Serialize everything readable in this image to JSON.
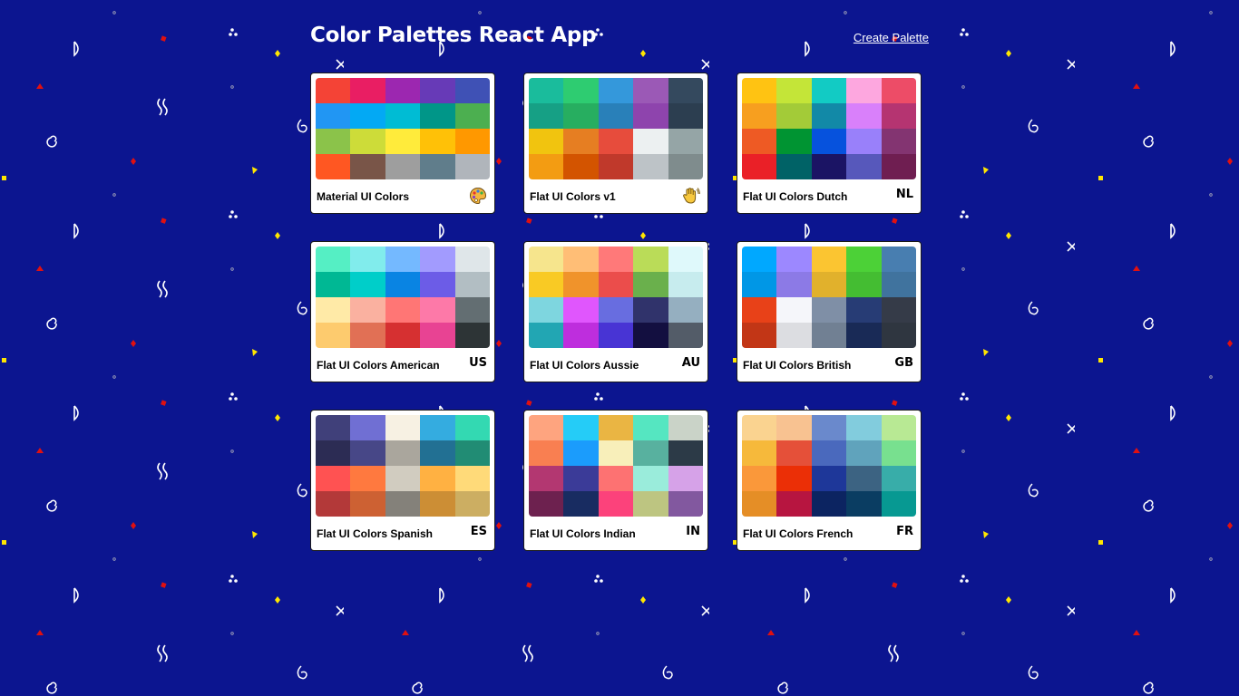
{
  "app": {
    "title": "Color Palettes React App",
    "create_link": "Create Palette"
  },
  "theme": {
    "background": "#0c1590"
  },
  "palettes": [
    {
      "name": "Material UI Colors",
      "emoji": "",
      "icon": "artist-palette-icon",
      "colors": [
        "#f44336",
        "#e91e63",
        "#9c27b0",
        "#673ab7",
        "#3f51b5",
        "#2196f3",
        "#03a9f4",
        "#00bcd4",
        "#009688",
        "#4caf50",
        "#8bc34a",
        "#cddc39",
        "#ffeb3b",
        "#ffc107",
        "#ff9800",
        "#ff5722",
        "#795548",
        "#9e9e9e",
        "#607d8b",
        "#b0b5bb"
      ]
    },
    {
      "name": "Flat UI Colors v1",
      "emoji": "",
      "icon": "waving-hand-icon",
      "colors": [
        "#1abc9c",
        "#2ecc71",
        "#3498db",
        "#9b59b6",
        "#34495e",
        "#16a085",
        "#27ae60",
        "#2980b9",
        "#8e44ad",
        "#2c3e50",
        "#f1c40f",
        "#e67e22",
        "#e74c3c",
        "#ecf0f1",
        "#95a5a6",
        "#f39c12",
        "#d35400",
        "#c0392b",
        "#bdc3c7",
        "#7f8c8d"
      ]
    },
    {
      "name": "Flat UI Colors Dutch",
      "emoji": "NL",
      "icon": "",
      "colors": [
        "#ffc312",
        "#c4e538",
        "#12cbc4",
        "#fda7df",
        "#ed4c67",
        "#f79f1f",
        "#a3cb38",
        "#1289a7",
        "#d980fa",
        "#b53471",
        "#ee5a24",
        "#009432",
        "#0652dd",
        "#9980fa",
        "#833471",
        "#ea2027",
        "#006266",
        "#1b1464",
        "#5758bb",
        "#6f1e51"
      ]
    },
    {
      "name": "Flat UI Colors American",
      "emoji": "US",
      "icon": "",
      "colors": [
        "#55efc4",
        "#81ecec",
        "#74b9ff",
        "#a29bfe",
        "#dfe6e9",
        "#00b894",
        "#00cec9",
        "#0984e3",
        "#6c5ce7",
        "#b2bec3",
        "#ffeaa7",
        "#fab1a0",
        "#ff7675",
        "#fd79a8",
        "#636e72",
        "#fdcb6e",
        "#e17055",
        "#d63031",
        "#e84393",
        "#2d3436"
      ]
    },
    {
      "name": "Flat UI Colors Aussie",
      "emoji": "AU",
      "icon": "",
      "colors": [
        "#f6e58d",
        "#ffbe76",
        "#ff7979",
        "#badc58",
        "#dff9fb",
        "#f9ca24",
        "#f0932b",
        "#eb4d4b",
        "#6ab04c",
        "#c7ecee",
        "#7ed6df",
        "#e056fd",
        "#686de0",
        "#30336b",
        "#95afc0",
        "#22a6b3",
        "#be2edd",
        "#4834d4",
        "#130f40",
        "#535c68"
      ]
    },
    {
      "name": "Flat UI Colors British",
      "emoji": "GB",
      "icon": "",
      "colors": [
        "#00a8ff",
        "#9c88ff",
        "#fbc531",
        "#4cd137",
        "#487eb0",
        "#0097e6",
        "#8c7ae6",
        "#e1b12c",
        "#44bd32",
        "#40739e",
        "#e84118",
        "#f5f6fa",
        "#7f8fa6",
        "#273c75",
        "#353b48",
        "#c23616",
        "#dcdde1",
        "#718093",
        "#192a56",
        "#2f3640"
      ]
    },
    {
      "name": "Flat UI Colors Spanish",
      "emoji": "ES",
      "icon": "",
      "colors": [
        "#40407a",
        "#706fd3",
        "#f7f1e3",
        "#34ace0",
        "#33d9b2",
        "#2c2c54",
        "#474787",
        "#aaa69d",
        "#227093",
        "#218c74",
        "#ff5252",
        "#ff793f",
        "#d1ccc0",
        "#ffb142",
        "#ffda79",
        "#b33939",
        "#cd6133",
        "#84817a",
        "#cc8e35",
        "#ccae62"
      ]
    },
    {
      "name": "Flat UI Colors Indian",
      "emoji": "IN",
      "icon": "",
      "colors": [
        "#fea47f",
        "#25ccf7",
        "#eab543",
        "#55e6c1",
        "#cad3c8",
        "#f97f51",
        "#1b9cfc",
        "#f8efba",
        "#58b19f",
        "#2c3a47",
        "#b33771",
        "#3b3b98",
        "#fd7272",
        "#9aecdb",
        "#d6a2e8",
        "#6d214f",
        "#182c61",
        "#fc427b",
        "#bdc581",
        "#82589f"
      ]
    },
    {
      "name": "Flat UI Colors French",
      "emoji": "FR",
      "icon": "",
      "colors": [
        "#fad390",
        "#f8c291",
        "#6a89cc",
        "#82ccdd",
        "#b8e994",
        "#f6b93b",
        "#e55039",
        "#4a69bd",
        "#60a3bc",
        "#78e08f",
        "#fa983a",
        "#eb2f06",
        "#1e3799",
        "#3c6382",
        "#38ada9",
        "#e58e26",
        "#b71540",
        "#0c2461",
        "#0a3d62",
        "#079992"
      ]
    }
  ]
}
